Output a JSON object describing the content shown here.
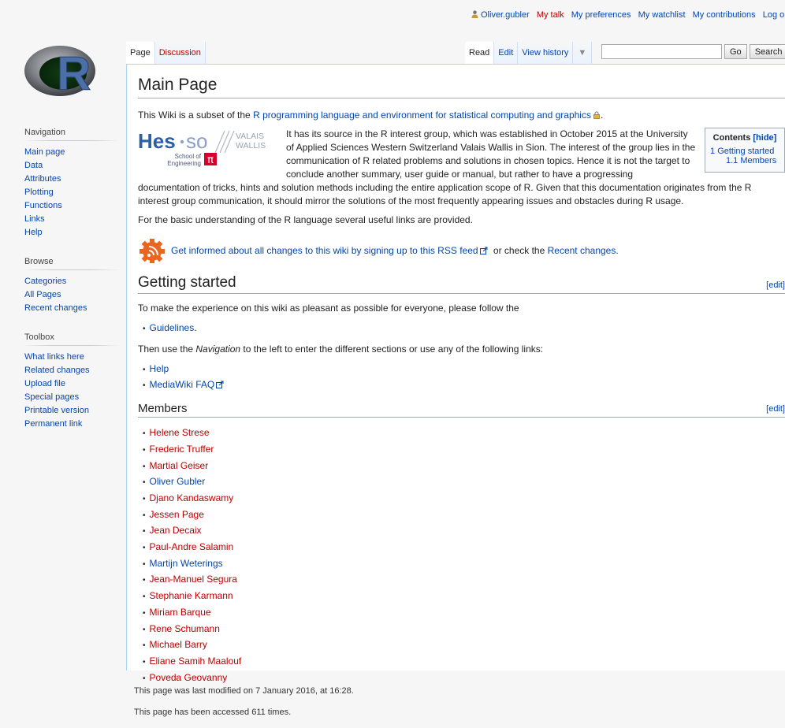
{
  "personal": {
    "user": "Oliver.gubler",
    "talk": "My talk",
    "preferences": "My preferences",
    "watchlist": "My watchlist",
    "contributions": "My contributions",
    "logout": "Log out"
  },
  "logo": {
    "letter": "R"
  },
  "sidebar": {
    "navigation": {
      "heading": "Navigation",
      "items": [
        "Main page",
        "Data",
        "Attributes",
        "Plotting",
        "Functions",
        "Links",
        "Help"
      ]
    },
    "browse": {
      "heading": "Browse",
      "items": [
        "Categories",
        "All Pages",
        "Recent changes"
      ]
    },
    "toolbox": {
      "heading": "Toolbox",
      "items": [
        "What links here",
        "Related changes",
        "Upload file",
        "Special pages",
        "Printable version",
        "Permanent link"
      ]
    }
  },
  "tabs": {
    "page": "Page",
    "discussion": "Discussion",
    "read": "Read",
    "edit": "Edit",
    "history": "View history",
    "more": "▼"
  },
  "search": {
    "placeholder": "",
    "go": "Go",
    "search": "Search"
  },
  "page": {
    "title": "Main Page",
    "intro_prefix": "This Wiki is a subset of the ",
    "intro_link": "R programming language and environment for statistical computing and graphics",
    "intro_suffix": ".",
    "hesso_logo": {
      "hes": "Hes",
      "so": "so",
      "valais": "VALAIS",
      "wallis": "WALLIS",
      "school": "School of",
      "engineering": "Engineering",
      "pi": "π"
    },
    "para1": "It has its source in the R interest group, which was established in October 2015 at the University of Applied Sciences Western Switzerland Valais Wallis in Sion. The interest of the group lies in the communication of R related problems and solutions in chosen topics. Hence it is not the target to conclude another summary, user guide or manual, but rather to have a progressing documentation of tricks, hints and solution methods including the entire application scope of R. Given that this documentation originates from the R interest group communication, it should mirror the solutions of the most frequently appearing issues and obstacles during R usage.",
    "para2": "For the basic understanding of the R language several useful links are provided.",
    "rss_link": "Get informed about all changes to this wiki by signing up to this RSS feed",
    "rss_or": " or check the ",
    "rss_recent": "Recent changes",
    "rss_end": ".",
    "toc": {
      "title": "Contents",
      "hide": "[hide]",
      "items": [
        {
          "num": "1",
          "label": "Getting started"
        },
        {
          "num": "1.1",
          "label": "Members"
        }
      ]
    },
    "getting_started": {
      "heading": "Getting started",
      "edit": "[edit]",
      "text1": "To make the experience on this wiki as pleasant as possible for everyone, please follow the",
      "guidelines": "Guidelines",
      "text2_a": "Then use the ",
      "text2_em": "Navigation",
      "text2_b": " to the left to enter the different sections or use any of the following links:",
      "links": [
        "Help",
        "MediaWiki FAQ"
      ]
    },
    "members": {
      "heading": "Members",
      "edit": "[edit]",
      "list": [
        {
          "name": "Helene Strese",
          "exists": false
        },
        {
          "name": "Frederic Truffer",
          "exists": false
        },
        {
          "name": "Martial Geiser",
          "exists": false
        },
        {
          "name": "Oliver Gubler",
          "exists": true
        },
        {
          "name": "Djano Kandaswamy",
          "exists": false
        },
        {
          "name": "Jessen Page",
          "exists": false
        },
        {
          "name": "Jean Decaix",
          "exists": false
        },
        {
          "name": "Paul-Andre Salamin",
          "exists": false
        },
        {
          "name": "Martijn Weterings",
          "exists": true
        },
        {
          "name": "Jean-Manuel Segura",
          "exists": false
        },
        {
          "name": "Stephanie Karmann",
          "exists": false
        },
        {
          "name": "Miriam Barque",
          "exists": false
        },
        {
          "name": "Rene Schumann",
          "exists": false
        },
        {
          "name": "Michael Barry",
          "exists": false
        },
        {
          "name": "Eliane Samih Maalouf",
          "exists": false
        },
        {
          "name": "Poveda Geovanny",
          "exists": false
        }
      ]
    }
  },
  "footer": {
    "modified": "This page was last modified on 7 January 2016, at 16:28.",
    "accessed": "This page has been accessed 611 times."
  },
  "colors": {
    "link": "#0645ad",
    "new_link": "#ba0000",
    "hes_blue": "#2d5fa5",
    "pi_red": "#d6002f",
    "rss_orange": "#e8671e"
  }
}
